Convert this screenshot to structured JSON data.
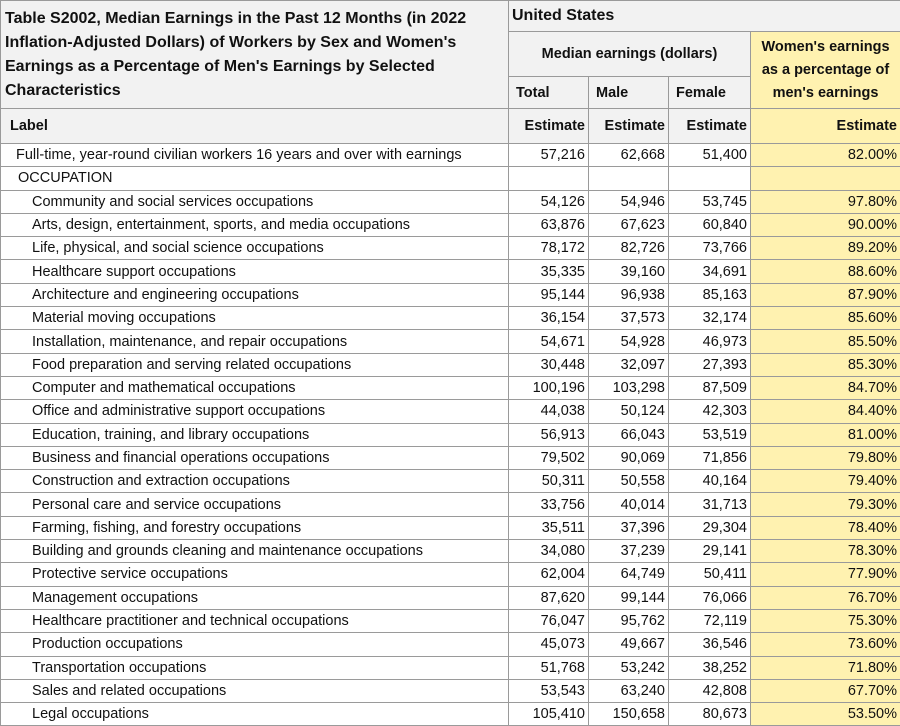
{
  "table": {
    "title": "Table S2002, Median Earnings in the Past 12 Months (in 2022 Inflation-Adjusted Dollars) of Workers by Sex and Women's Earnings as a Percentage of Men's Earnings by Selected Characteristics",
    "geography": "United States",
    "median_header": "Median earnings (dollars)",
    "women_header": "Women's earnings as a percentage of men's earnings",
    "col_total": "Total",
    "col_male": "Male",
    "col_female": "Female",
    "label_header": "Label",
    "estimate_label": "Estimate",
    "accent_color": "#fff2b0",
    "summary": {
      "label": "Full-time, year-round civilian workers 16 years and over with earnings",
      "total": "57,216",
      "male": "62,668",
      "female": "51,400",
      "pct": "82.00%"
    },
    "section_label": "OCCUPATION",
    "rows": [
      {
        "label": "Community and social services occupations",
        "total": "54,126",
        "male": "54,946",
        "female": "53,745",
        "pct": "97.80%"
      },
      {
        "label": "Arts, design, entertainment, sports, and media occupations",
        "total": "63,876",
        "male": "67,623",
        "female": "60,840",
        "pct": "90.00%"
      },
      {
        "label": "Life, physical, and social science occupations",
        "total": "78,172",
        "male": "82,726",
        "female": "73,766",
        "pct": "89.20%"
      },
      {
        "label": "Healthcare support occupations",
        "total": "35,335",
        "male": "39,160",
        "female": "34,691",
        "pct": "88.60%"
      },
      {
        "label": "Architecture and engineering occupations",
        "total": "95,144",
        "male": "96,938",
        "female": "85,163",
        "pct": "87.90%"
      },
      {
        "label": "Material moving occupations",
        "total": "36,154",
        "male": "37,573",
        "female": "32,174",
        "pct": "85.60%"
      },
      {
        "label": "Installation, maintenance, and repair occupations",
        "total": "54,671",
        "male": "54,928",
        "female": "46,973",
        "pct": "85.50%"
      },
      {
        "label": "Food preparation and serving related occupations",
        "total": "30,448",
        "male": "32,097",
        "female": "27,393",
        "pct": "85.30%"
      },
      {
        "label": "Computer and mathematical occupations",
        "total": "100,196",
        "male": "103,298",
        "female": "87,509",
        "pct": "84.70%"
      },
      {
        "label": "Office and administrative support occupations",
        "total": "44,038",
        "male": "50,124",
        "female": "42,303",
        "pct": "84.40%"
      },
      {
        "label": "Education, training, and library occupations",
        "total": "56,913",
        "male": "66,043",
        "female": "53,519",
        "pct": "81.00%"
      },
      {
        "label": "Business and financial operations occupations",
        "total": "79,502",
        "male": "90,069",
        "female": "71,856",
        "pct": "79.80%"
      },
      {
        "label": "Construction and extraction occupations",
        "total": "50,311",
        "male": "50,558",
        "female": "40,164",
        "pct": "79.40%"
      },
      {
        "label": "Personal care and service occupations",
        "total": "33,756",
        "male": "40,014",
        "female": "31,713",
        "pct": "79.30%"
      },
      {
        "label": "Farming, fishing, and forestry occupations",
        "total": "35,511",
        "male": "37,396",
        "female": "29,304",
        "pct": "78.40%"
      },
      {
        "label": "Building and grounds cleaning and maintenance occupations",
        "total": "34,080",
        "male": "37,239",
        "female": "29,141",
        "pct": "78.30%"
      },
      {
        "label": "Protective service occupations",
        "total": "62,004",
        "male": "64,749",
        "female": "50,411",
        "pct": "77.90%"
      },
      {
        "label": "Management occupations",
        "total": "87,620",
        "male": "99,144",
        "female": "76,066",
        "pct": "76.70%"
      },
      {
        "label": "Healthcare practitioner and technical occupations",
        "total": "76,047",
        "male": "95,762",
        "female": "72,119",
        "pct": "75.30%"
      },
      {
        "label": "Production occupations",
        "total": "45,073",
        "male": "49,667",
        "female": "36,546",
        "pct": "73.60%"
      },
      {
        "label": "Transportation occupations",
        "total": "51,768",
        "male": "53,242",
        "female": "38,252",
        "pct": "71.80%"
      },
      {
        "label": "Sales and related occupations",
        "total": "53,543",
        "male": "63,240",
        "female": "42,808",
        "pct": "67.70%"
      },
      {
        "label": "Legal occupations",
        "total": "105,410",
        "male": "150,658",
        "female": "80,673",
        "pct": "53.50%"
      }
    ]
  }
}
